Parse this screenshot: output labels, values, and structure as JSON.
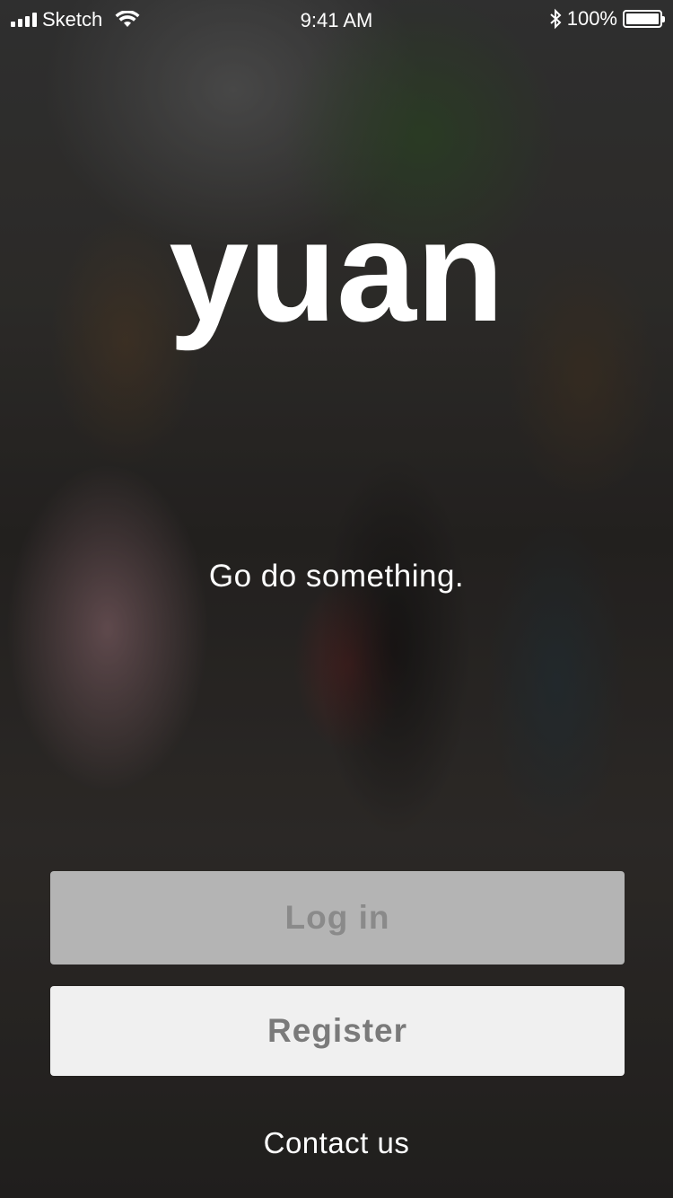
{
  "status_bar": {
    "carrier": "Sketch",
    "time": "9:41 AM",
    "battery_percent": "100%"
  },
  "app": {
    "logo_text": "yuan",
    "tagline": "Go do something."
  },
  "actions": {
    "login_label": "Log in",
    "register_label": "Register",
    "contact_label": "Contact us"
  },
  "colors": {
    "login_bg": "#b4b4b4",
    "login_text": "#8a8a8a",
    "register_bg": "#f0f0f0",
    "register_text": "#7a7a7a",
    "text_on_photo": "#ffffff"
  }
}
